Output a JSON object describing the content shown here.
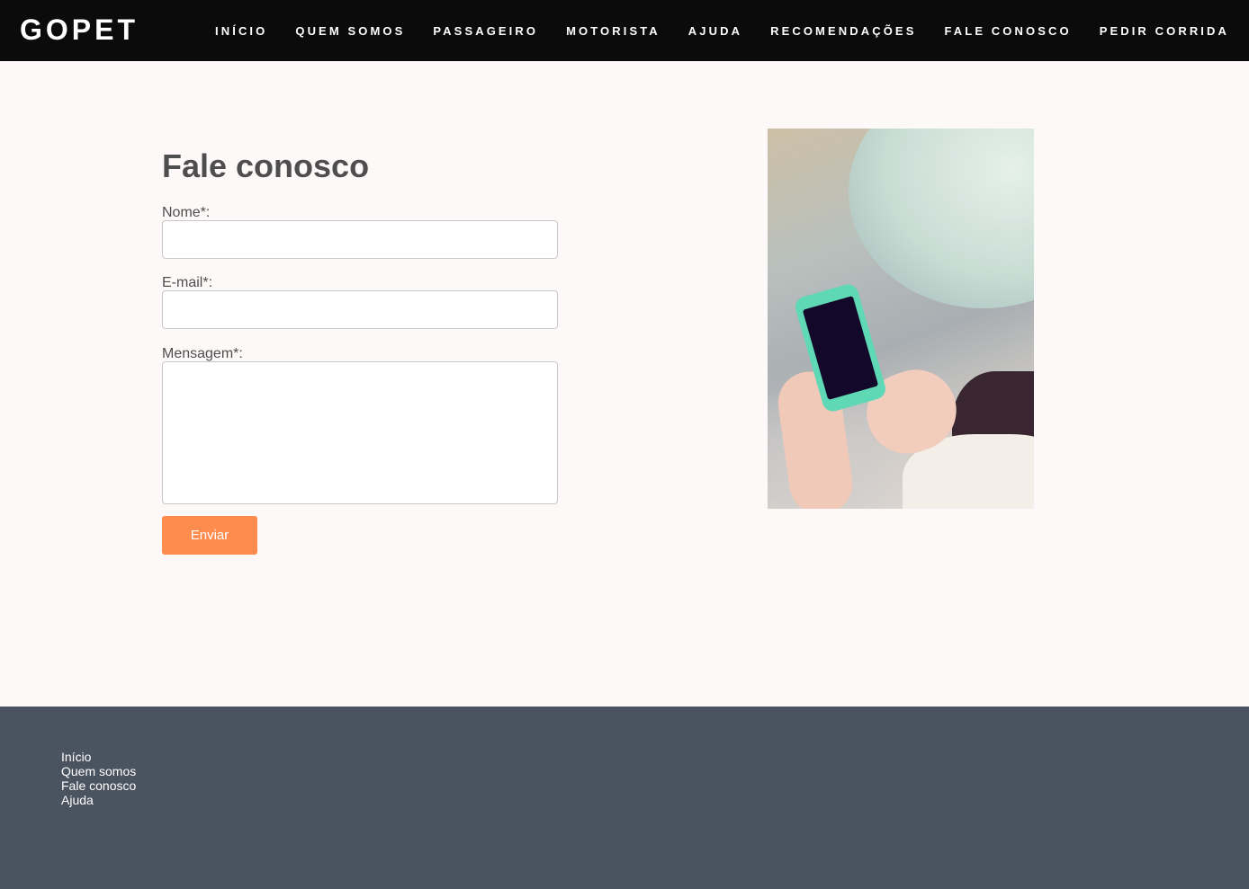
{
  "header": {
    "logo": "GOPET",
    "nav": [
      {
        "label": "INÍCIO"
      },
      {
        "label": "QUEM SOMOS"
      },
      {
        "label": "PASSAGEIRO"
      },
      {
        "label": "MOTORISTA"
      },
      {
        "label": "AJUDA"
      },
      {
        "label": "RECOMENDAÇÕES"
      },
      {
        "label": "FALE CONOSCO"
      },
      {
        "label": "PEDIR CORRIDA"
      }
    ]
  },
  "form": {
    "title": "Fale conosco",
    "name_label": "Nome*:",
    "name_value": "",
    "email_label": "E-mail*:",
    "email_value": "",
    "message_label": "Mensagem*:",
    "message_value": "",
    "submit_label": "Enviar"
  },
  "image": {
    "subject": "woman holding smartphone"
  },
  "footer": {
    "links": [
      {
        "label": "Início"
      },
      {
        "label": "Quem somos"
      },
      {
        "label": "Fale conosco"
      },
      {
        "label": "Ajuda"
      }
    ]
  },
  "colors": {
    "header_bg": "#0b0b0b",
    "page_bg": "#fdf9f8",
    "button_accent": "#fe8c4e",
    "footer_bg": "#4a5360",
    "heading_text": "#4e4e4e"
  }
}
